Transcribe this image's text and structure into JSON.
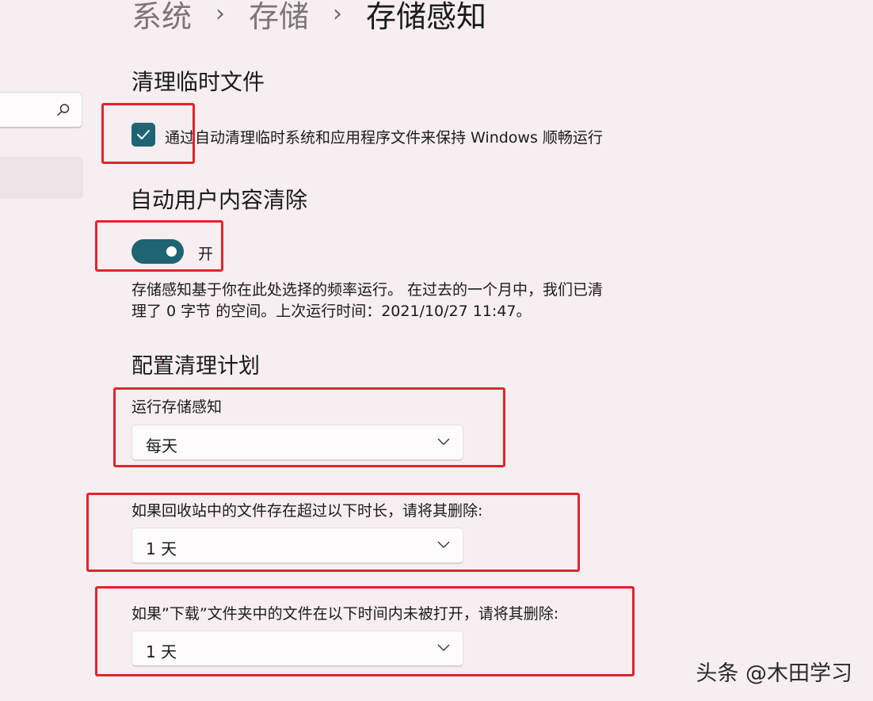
{
  "breadcrumb": {
    "items": [
      "系统",
      "存储",
      "存储感知"
    ],
    "separator": "›"
  },
  "temp_files": {
    "title": "清理临时文件",
    "checkbox_label": "通过自动清理临时系统和应用程序文件来保持 Windows 顺畅运行",
    "checked": true
  },
  "auto_cleanup": {
    "title": "自动用户内容清除",
    "toggle_label": "开",
    "toggle_on": true,
    "description_line1": "存储感知基于你在此处选择的频率运行。 在过去的一个月中，我们已清",
    "description_line2": "理了 0 字节 的空间。上次运行时间：2021/10/27 11:47。"
  },
  "schedule": {
    "title": "配置清理计划",
    "run_label": "运行存储感知",
    "run_value": "每天",
    "recycle_label": "如果回收站中的文件存在超过以下时长，请将其删除:",
    "recycle_value": "1 天",
    "downloads_label": "如果”下载”文件夹中的文件在以下时间内未被打开，请将其删除:",
    "downloads_value": "1 天"
  },
  "watermark": "头条 @木田学习",
  "colors": {
    "accent": "#1f6472",
    "annotation": "#e3232b",
    "background": "#f6eef0"
  }
}
